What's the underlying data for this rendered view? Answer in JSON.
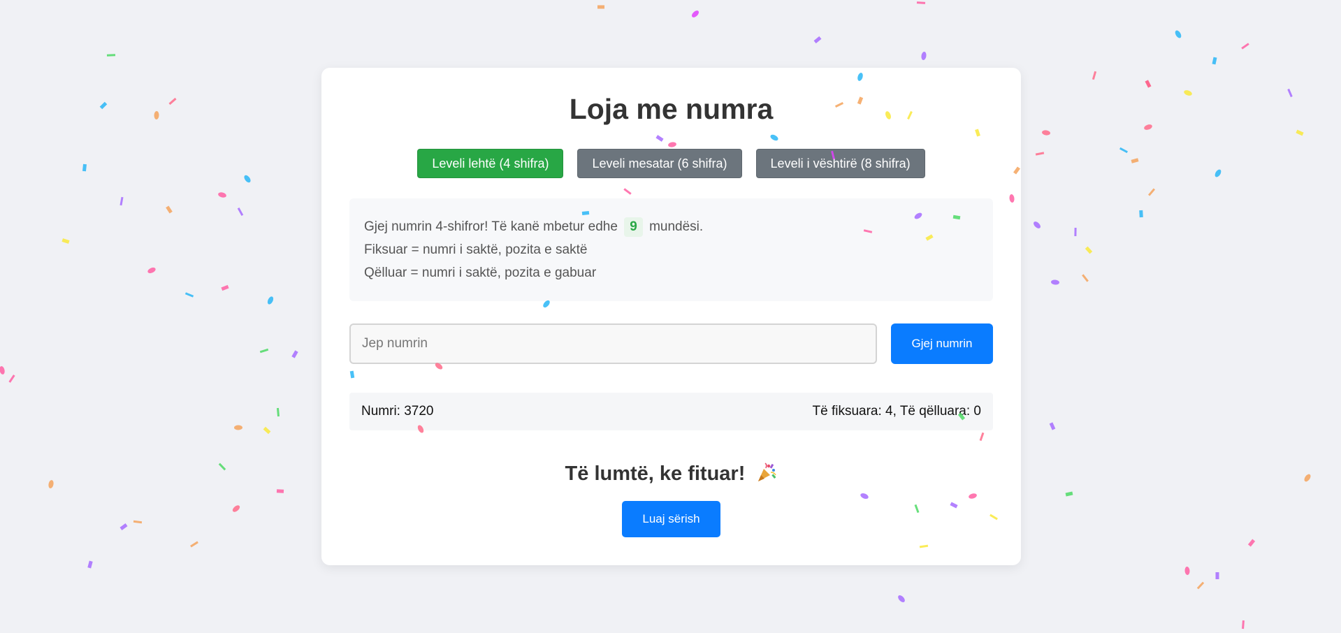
{
  "game": {
    "title": "Loja me numra",
    "levels": [
      {
        "label": "Leveli lehtë (4 shifra)",
        "state": "active"
      },
      {
        "label": "Leveli mesatar (6 shifra)",
        "state": "inactive"
      },
      {
        "label": "Leveli i vështirë (8 shifra)",
        "state": "inactive"
      }
    ],
    "info": {
      "line1_before": "Gjej numrin 4-shifror! Të kanë mbetur edhe",
      "attempts_left": "9",
      "line1_after": "mundësi.",
      "line2": "Fiksuar = numri i saktë, pozita e saktë",
      "line3": "Qëlluar = numri i saktë, pozita e gabuar"
    },
    "input": {
      "placeholder": "Jep numrin",
      "value": ""
    },
    "guess_button": "Gjej numrin",
    "result": {
      "number": "Numri: 3720",
      "score": "Të fiksuara: 4, Të qëlluara: 0"
    },
    "win_message": "Të lumtë, ke fituar!",
    "win_icon": "party-popper-icon",
    "play_again_button": "Luaj sërish"
  },
  "colors": {
    "background": "#f0f1f5",
    "card": "#ffffff",
    "active_level": "#28a745",
    "inactive_level": "#6c757d",
    "primary_button": "#0a7cff",
    "badge_text": "#28a745"
  },
  "decoration": "confetti"
}
